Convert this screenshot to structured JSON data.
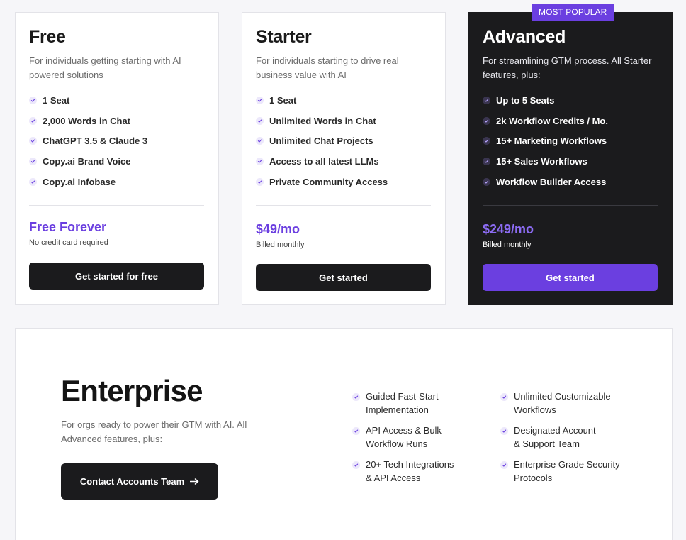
{
  "plans": [
    {
      "title": "Free",
      "description": "For individuals getting starting with AI powered solutions",
      "features": [
        "1 Seat",
        "2,000 Words in Chat",
        "ChatGPT 3.5 & Claude 3",
        "Copy.ai Brand Voice",
        "Copy.ai Infobase"
      ],
      "price": "Free Forever",
      "price_note": "No credit card required",
      "cta": "Get started for free"
    },
    {
      "title": "Starter",
      "description": "For individuals starting to drive real business value with AI",
      "features": [
        "1 Seat",
        "Unlimited Words in Chat",
        "Unlimited Chat Projects",
        "Access to all latest LLMs",
        "Private Community Access"
      ],
      "price": "$49/mo",
      "price_note": "Billed monthly",
      "cta": "Get started"
    },
    {
      "title": "Advanced",
      "badge": "MOST POPULAR",
      "description": "For streamlining GTM process. All Starter features, plus:",
      "features": [
        "Up to 5 Seats",
        "2k Workflow Credits / Mo.",
        "15+ Marketing Workflows",
        "15+ Sales Workflows",
        "Workflow Builder Access"
      ],
      "price": "$249/mo",
      "price_note": "Billed monthly",
      "cta": "Get started"
    }
  ],
  "enterprise": {
    "title": "Enterprise",
    "description": "For orgs ready to power their GTM with AI. All Advanced features, plus:",
    "cta": "Contact Accounts Team",
    "cta_icon": "arrow-right-icon",
    "features_col1": [
      "Guided Fast-Start\nImplementation",
      "API Access & Bulk\nWorkflow Runs",
      "20+ Tech Integrations\n& API Access"
    ],
    "features_col2": [
      "Unlimited Customizable\nWorkflows",
      "Designated Account\n& Support Team",
      "Enterprise Grade Security\nProtocols"
    ]
  },
  "colors": {
    "accent": "#6b3fe0",
    "dark": "#1b1b1d",
    "background": "#f6f6f9"
  }
}
